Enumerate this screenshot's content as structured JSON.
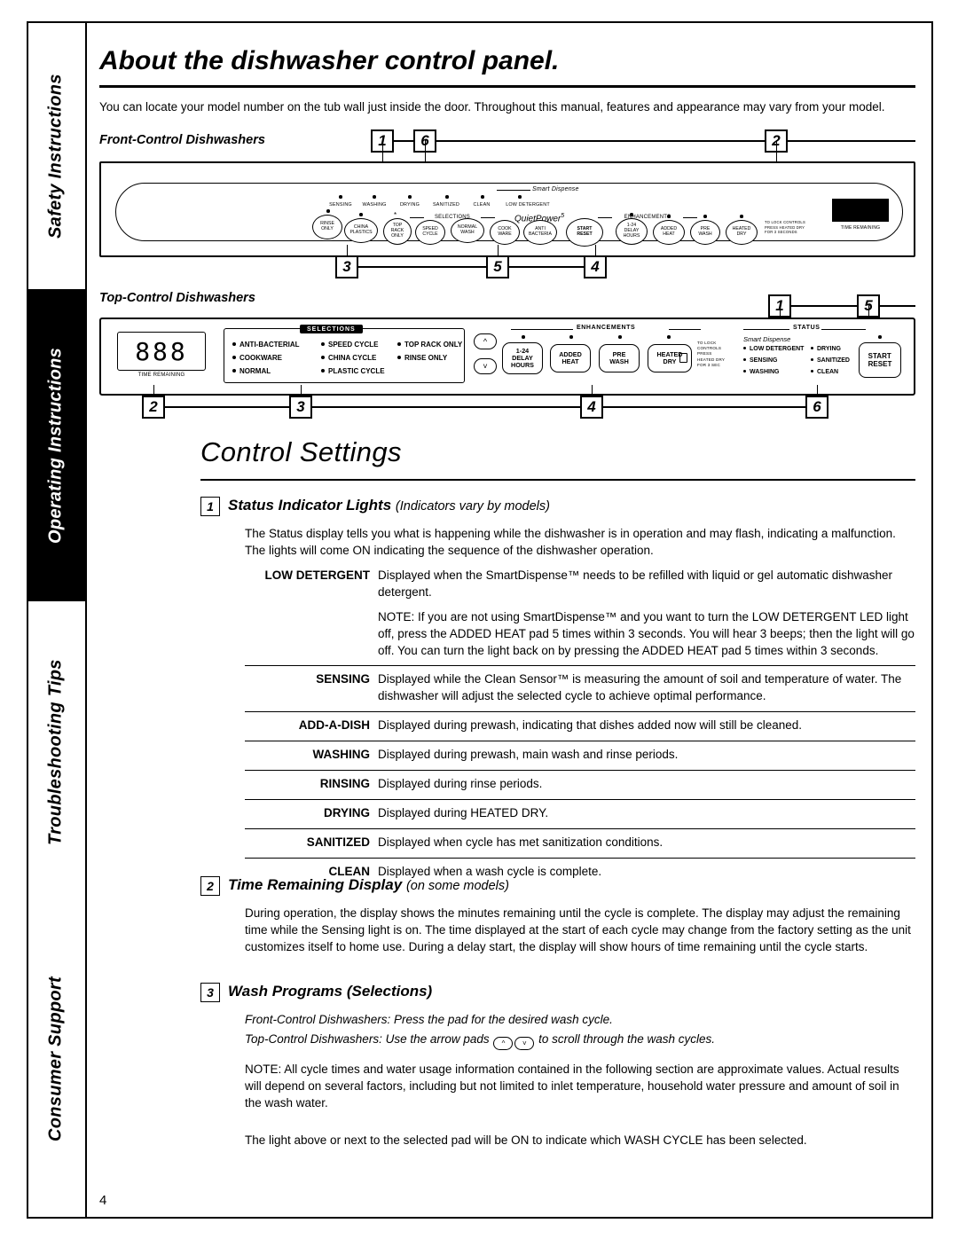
{
  "page": {
    "title": "About the dishwasher control panel.",
    "intro": "You can locate your model number on the tub wall just inside the door. Throughout this manual, features and appearance may vary from your model.",
    "number": "4"
  },
  "sidebar": {
    "tabs": [
      {
        "label": "Safety Instructions",
        "dark": false
      },
      {
        "label": "Operating Instructions",
        "dark": true
      },
      {
        "label": "Troubleshooting Tips",
        "dark": false
      },
      {
        "label": "Consumer Support",
        "dark": false
      }
    ]
  },
  "front_panel": {
    "heading": "Front-Control Dishwashers",
    "callouts": [
      "1",
      "6",
      "2",
      "3",
      "5",
      "4"
    ],
    "status_lights": [
      "SENSING",
      "WASHING",
      "DRYING",
      "SANITIZED",
      "CLEAN"
    ],
    "low_detergent_label": "LOW DETERGENT",
    "smart_dispense": "Smart Dispense",
    "selections_label": "SELECTIONS",
    "brand": "QuietPower",
    "brand_sup": "5",
    "enhancements_label": "ENHANCEMENTS",
    "time_remaining": "TIME REMAINING",
    "cycle_pads": [
      "RINSE\nONLY",
      "CHINA\nPLASTICS",
      "TOP\nRACK\nONLY",
      "SPEED\nCYCLE",
      "NORMAL\nWASH",
      "COOK\nWARE",
      "ANTI\nBACTERIA"
    ],
    "start_pad": "START\nRESET",
    "enhancement_pads": [
      "1-24\nDELAY\nHOURS",
      "ADDED\nHEAT",
      "PRE\nWASH",
      "HEATED\nDRY"
    ],
    "lock_text": "TO LOCK CONTROLS\nPRESS HEATED DRY\nFOR 3 SECONDS"
  },
  "top_panel": {
    "heading": "Top-Control Dishwashers",
    "callouts": [
      "1",
      "5",
      "2",
      "3",
      "4",
      "6"
    ],
    "display_value": "888",
    "time_remaining": "TIME REMAINING",
    "selections_label": "SELECTIONS",
    "selections": [
      [
        "ANTI-BACTERIAL",
        "SPEED CYCLE",
        "TOP RACK ONLY"
      ],
      [
        "COOKWARE",
        "CHINA CYCLE",
        "RINSE ONLY"
      ],
      [
        "NORMAL",
        "PLASTIC CYCLE",
        ""
      ]
    ],
    "enhancements_label": "ENHANCEMENTS",
    "enhancement_pads": [
      "1-24\nDELAY\nHOURS",
      "ADDED\nHEAT",
      "PRE\nWASH",
      "HEATED\nDRY"
    ],
    "lock_text": "TO LOCK\nCONTROLS\nPRESS\nHEATED DRY\nFOR 3 SEC",
    "status_label": "STATUS",
    "smart_dispense": "Smart Dispense",
    "status_items_left": [
      "LOW DETERGENT",
      "SENSING",
      "WASHING"
    ],
    "status_items_right": [
      "DRYING",
      "SANITIZED",
      "CLEAN"
    ],
    "start_pad": "START\nRESET"
  },
  "control_settings": {
    "title": "Control Settings",
    "sections": [
      {
        "num": "1",
        "title": "Status Indicator Lights",
        "subtitle": "(Indicators vary by models)",
        "body": "The Status display tells you what is happening while the dishwasher is in operation and may flash, indicating a malfunction. The lights will come ON indicating the sequence of the dishwasher operation."
      },
      {
        "num": "2",
        "title": "Time Remaining Display",
        "subtitle": "(on some models)",
        "body": "During operation, the display shows the minutes remaining until the cycle is complete. The display may adjust the remaining time while the Sensing light is on. The time displayed at the start of each cycle may change from the factory setting as the unit customizes itself to home use. During a delay start, the display will show hours of time remaining until the cycle starts."
      },
      {
        "num": "3",
        "title": "Wash Programs",
        "subtitle": "(Selections)",
        "line1": "Front-Control Dishwashers: Press the pad for the desired wash cycle.",
        "line2_pre": "Top-Control Dishwashers: Use the arrow pads",
        "line2_post": "to scroll through the wash cycles.",
        "note": "NOTE: All cycle times and water usage information contained in the following section are approximate values. Actual results will depend on several factors, including but not limited to inlet temperature, household water pressure and amount of soil in the wash water.",
        "closing": "The light above or next to the selected pad will be ON to indicate which WASH CYCLE has been selected."
      }
    ],
    "definitions": [
      {
        "term": "LOW DETERGENT",
        "body": "Displayed when the SmartDispense™ needs to be refilled with liquid or gel automatic dishwasher detergent."
      },
      {
        "term": "",
        "body": "NOTE: If you are not using SmartDispense™ and you want to turn the LOW DETERGENT LED light off, press the ADDED HEAT pad 5 times within 3 seconds. You will hear 3 beeps; then the light will go off. You can turn the light back on by pressing the ADDED HEAT pad 5 times within 3 seconds.",
        "is_note": true
      },
      {
        "term": "SENSING",
        "body": "Displayed while the Clean Sensor™ is measuring the amount of soil and temperature of water. The dishwasher will adjust the selected cycle to achieve optimal performance."
      },
      {
        "term": "ADD-A-DISH",
        "body": "Displayed during prewash, indicating that dishes added now will still be cleaned."
      },
      {
        "term": "WASHING",
        "body": "Displayed during prewash, main wash and rinse periods."
      },
      {
        "term": "RINSING",
        "body": "Displayed during rinse periods."
      },
      {
        "term": "DRYING",
        "body": "Displayed during HEATED DRY."
      },
      {
        "term": "SANITIZED",
        "body": "Displayed when cycle has met sanitization conditions."
      },
      {
        "term": "CLEAN",
        "body": "Displayed when a wash cycle is complete."
      }
    ]
  }
}
